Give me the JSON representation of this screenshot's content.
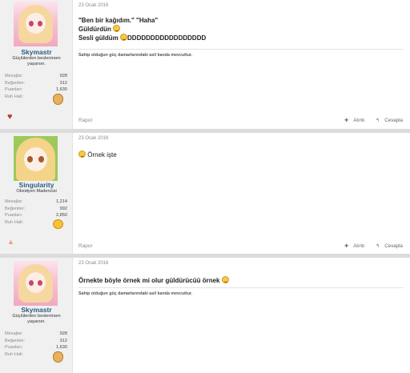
{
  "posts": [
    {
      "date": "23 Ocak 2016",
      "user": {
        "name": "Skymastr",
        "title": "Güçlülerden beslenirsen yaşarsın."
      },
      "stats": [
        {
          "label": "Mesajlar:",
          "value": "928"
        },
        {
          "label": "Beğeniler:",
          "value": "312"
        },
        {
          "label": "Puanları:",
          "value": "1,630"
        },
        {
          "label": "Ruh Hali:",
          "value": ""
        }
      ],
      "message": [
        "\"Ben bir kağıdım.\" \"Haha\"",
        "Güldürdün",
        "Sesli güldüm",
        "DDDDDDDDDDDDDDDDD"
      ],
      "signature": "Sahip olduğun güç damarlarındaki asil kanda mevcuttur.",
      "report": "Rapor",
      "quote": "Alıntı",
      "reply": "Cevapla"
    },
    {
      "date": "23 Ocak 2016",
      "user": {
        "name": "Singularity",
        "title": "Obsidyen Madencisi"
      },
      "stats": [
        {
          "label": "Mesajlar:",
          "value": "1,214"
        },
        {
          "label": "Beğeniler:",
          "value": "992"
        },
        {
          "label": "Puanları:",
          "value": "2,850"
        },
        {
          "label": "Ruh Hali:",
          "value": ""
        }
      ],
      "message": [
        "Örnek işte"
      ],
      "report": "Rapor",
      "quote": "Alıntı",
      "reply": "Cevapla"
    },
    {
      "date": "23 Ocak 2016",
      "user": {
        "name": "Skymastr",
        "title": "Güçlülerden beslenirsen yaşarsın."
      },
      "stats": [
        {
          "label": "Mesajlar:",
          "value": "928"
        },
        {
          "label": "Beğeniler:",
          "value": "312"
        },
        {
          "label": "Puanları:",
          "value": "1,630"
        },
        {
          "label": "Ruh Hali:",
          "value": ""
        }
      ],
      "message": [
        "Örnekte böyle örnek mi olur güldürücüü örnek"
      ],
      "signature": "Sahip olduğun güç damarlarındaki asil kanda mevcuttur."
    }
  ],
  "icons": {
    "mood": "grinning-face-icon",
    "smiley": "laughing-emoji-icon",
    "like": "heart-icon",
    "trophy": "star-icon",
    "quote": "plus-icon",
    "reply": "reply-arrow-icon"
  },
  "colors": {
    "username": "#2b5d86",
    "online_bar": "#29a3c9",
    "heart": "#c0392b"
  }
}
